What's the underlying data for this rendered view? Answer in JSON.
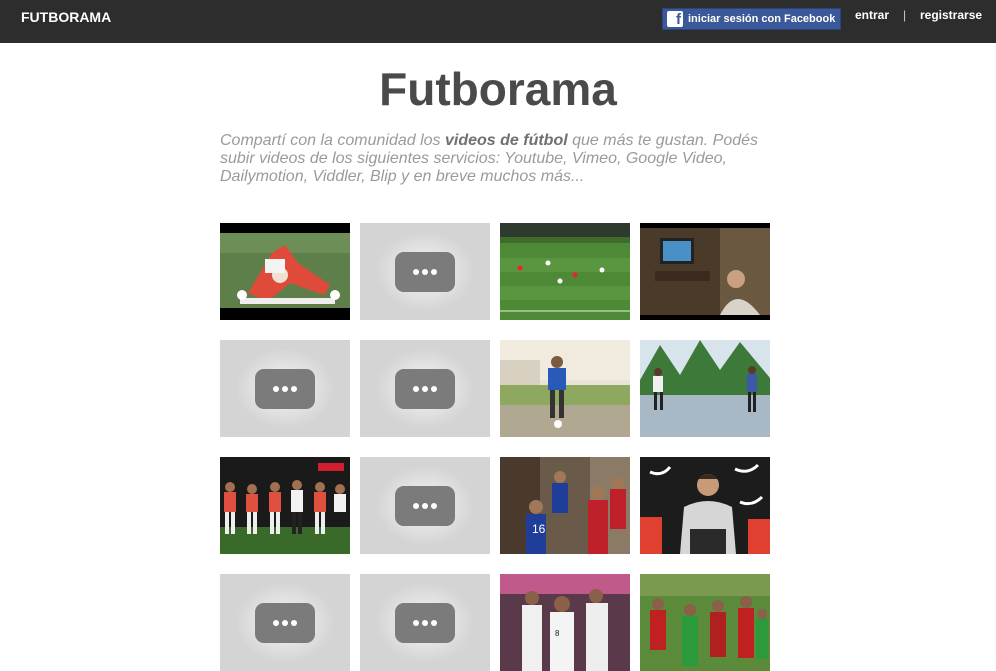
{
  "header": {
    "brand": "FUTBORAMA",
    "facebook_login": "iniciar sesión con Facebook",
    "facebook_icon": "facebook-f-icon",
    "login": "entrar",
    "separator": "|",
    "register": "registrarse"
  },
  "main": {
    "title": "Futborama",
    "intro_before": "Compartí con la comunidad los ",
    "intro_bold": "videos de fútbol",
    "intro_after": " que más te gustan. Podés subir videos de los siguientes servicios: Youtube, Vimeo, Google Video, Dailymotion, Viddler, Blip y en breve muchos más..."
  },
  "videos": [
    {
      "kind": "thumbnail",
      "scene": "player-in-red-lying-on-pitch"
    },
    {
      "kind": "placeholder",
      "icon": "video-placeholder-icon"
    },
    {
      "kind": "thumbnail",
      "scene": "wide-pitch-view"
    },
    {
      "kind": "thumbnail",
      "scene": "man-watching-tv-in-dark-room"
    },
    {
      "kind": "placeholder",
      "icon": "video-placeholder-icon"
    },
    {
      "kind": "placeholder",
      "icon": "video-placeholder-icon"
    },
    {
      "kind": "thumbnail",
      "scene": "boy-juggling-ball-on-grass"
    },
    {
      "kind": "thumbnail",
      "scene": "street-football-under-palms"
    },
    {
      "kind": "thumbnail",
      "scene": "team-celebrating-on-pitch"
    },
    {
      "kind": "placeholder",
      "icon": "video-placeholder-icon"
    },
    {
      "kind": "thumbnail",
      "scene": "players-walking-in-tunnel"
    },
    {
      "kind": "thumbnail",
      "scene": "coach-seated-in-dugout"
    },
    {
      "kind": "placeholder",
      "icon": "video-placeholder-icon"
    },
    {
      "kind": "placeholder",
      "icon": "video-placeholder-icon"
    },
    {
      "kind": "thumbnail",
      "scene": "players-group-hug"
    },
    {
      "kind": "thumbnail",
      "scene": "players-arguing-with-referee"
    }
  ]
}
